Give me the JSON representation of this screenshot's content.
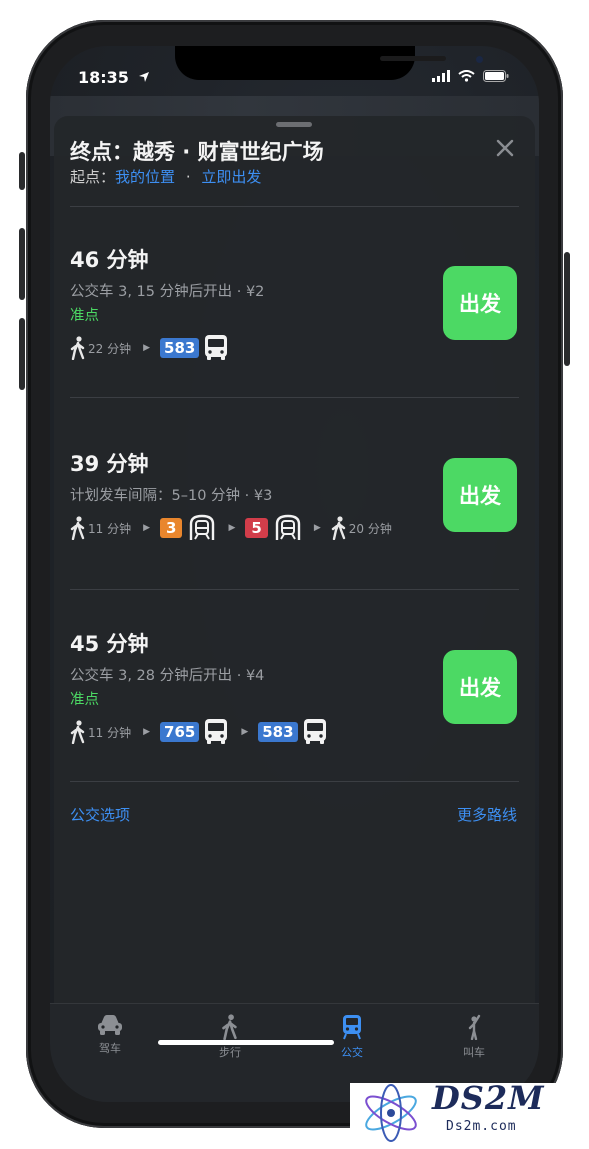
{
  "status": {
    "time": "18:35"
  },
  "header": {
    "title": "终点：越秀 · 财富世纪广场",
    "origin_label": "起点：",
    "origin_value": "我的位置",
    "dot": "·",
    "depart": "立即出发"
  },
  "routes": [
    {
      "duration": "46 分钟",
      "info": "公交车 3, 15 分钟后开出 · ¥2",
      "status": "准点",
      "walk": "22 分钟",
      "line1": "583",
      "go": "出发"
    },
    {
      "duration": "39 分钟",
      "info": "计划发车间隔：5–10 分钟 · ¥3",
      "walk1": "11 分钟",
      "line1": "3",
      "line2": "5",
      "walk2": "20 分钟",
      "go": "出发"
    },
    {
      "duration": "45 分钟",
      "info": "公交车 3, 28 分钟后开出 · ¥4",
      "status": "准点",
      "walk": "11 分钟",
      "line1": "765",
      "line2": "583",
      "go": "出发"
    }
  ],
  "options": {
    "transit_options": "公交选项",
    "more_routes": "更多路线"
  },
  "tabs": [
    {
      "label": "驾车",
      "icon": "car-icon"
    },
    {
      "label": "步行",
      "icon": "walk-icon"
    },
    {
      "label": "公交",
      "icon": "transit-icon",
      "active": true
    },
    {
      "label": "叫车",
      "icon": "ride-icon"
    }
  ],
  "watermark": {
    "brand": "DS2M",
    "site": "Ds2m.com"
  },
  "colors": {
    "accent": "#3d8ff2",
    "go_green": "#4cd964",
    "line_orange": "#e9862d",
    "line_red": "#d23d4a",
    "bus_blue": "#3b78cf"
  }
}
